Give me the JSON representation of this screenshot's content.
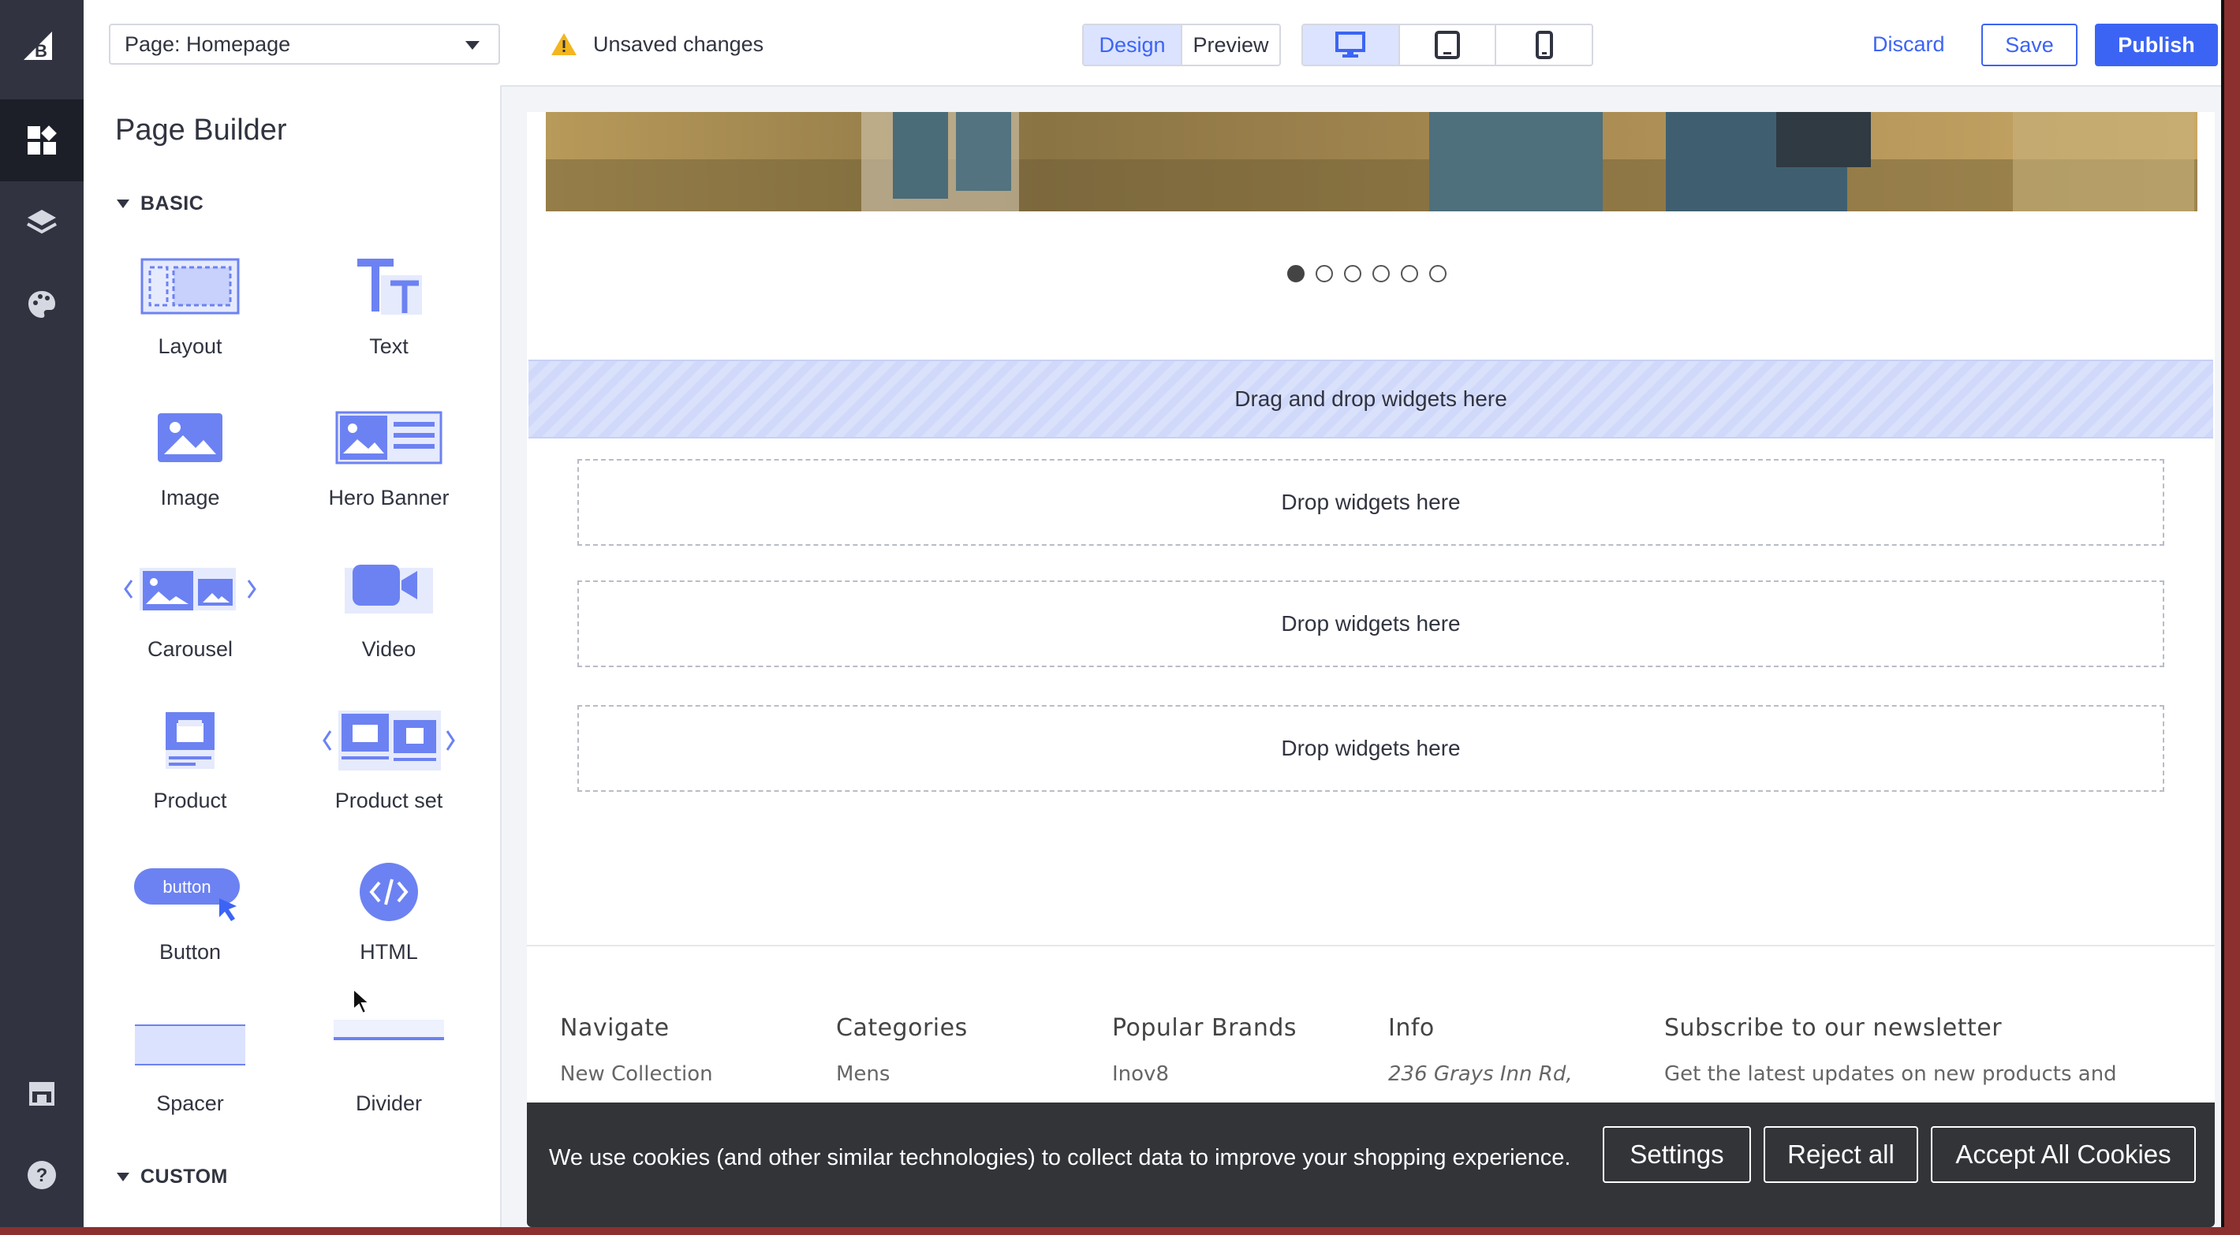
{
  "topbar": {
    "page_select": "Page: Homepage",
    "unsaved": "Unsaved changes",
    "modes": [
      "Design",
      "Preview"
    ],
    "active_mode": "Design",
    "devices": [
      "desktop-icon",
      "tablet-icon",
      "mobile-icon"
    ],
    "active_device": "desktop",
    "discard": "Discard",
    "save": "Save",
    "publish": "Publish"
  },
  "rail": {
    "items": [
      "widgets-icon",
      "layers-icon",
      "palette-icon",
      "store-icon",
      "help-icon"
    ],
    "active": "widgets-icon"
  },
  "panel": {
    "title": "Page Builder",
    "basic_heading": "BASIC",
    "custom_heading": "CUSTOM",
    "widgets": [
      {
        "label": "Layout",
        "icon": "layout-icon"
      },
      {
        "label": "Text",
        "icon": "text-icon"
      },
      {
        "label": "Image",
        "icon": "image-icon"
      },
      {
        "label": "Hero Banner",
        "icon": "hero-banner-icon"
      },
      {
        "label": "Carousel",
        "icon": "carousel-icon"
      },
      {
        "label": "Video",
        "icon": "video-icon"
      },
      {
        "label": "Product",
        "icon": "product-icon"
      },
      {
        "label": "Product set",
        "icon": "product-set-icon"
      },
      {
        "label": "Button",
        "icon": "button-icon",
        "icon_text": "button"
      },
      {
        "label": "HTML",
        "icon": "html-icon"
      },
      {
        "label": "Spacer",
        "icon": "spacer-icon"
      },
      {
        "label": "Divider",
        "icon": "divider-icon"
      }
    ]
  },
  "canvas": {
    "carousel_dots": 6,
    "active_dot": 1,
    "main_dropzone": "Drag and drop widgets here",
    "dropzones": [
      "Drop widgets here",
      "Drop widgets here",
      "Drop widgets here"
    ],
    "footer": {
      "columns": [
        {
          "heading": "Navigate",
          "first_item": "New Collection"
        },
        {
          "heading": "Categories",
          "first_item": "Mens"
        },
        {
          "heading": "Popular Brands",
          "first_item": "Inov8"
        },
        {
          "heading": "Info",
          "first_item": "236 Grays Inn Rd,"
        },
        {
          "heading": "Subscribe to our newsletter",
          "first_item": "Get the latest updates on new products and"
        }
      ]
    },
    "cookie_banner": {
      "message": "We use cookies (and other similar technologies) to collect data to improve your shopping experience.",
      "settings": "Settings",
      "reject": "Reject all",
      "accept": "Accept All Cookies"
    }
  },
  "colors": {
    "accent": "#3c64f4",
    "rail": "#313440",
    "widget_icon": "#7b8ff5"
  }
}
